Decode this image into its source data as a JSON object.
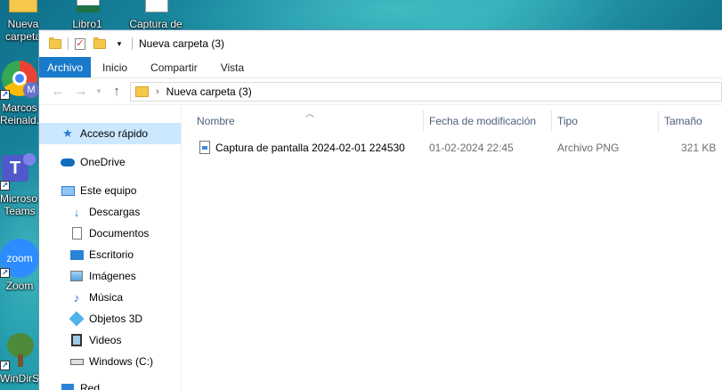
{
  "desktop": {
    "icons": [
      {
        "name": "nueva-carpeta",
        "label": "Nueva carpeta",
        "line1": "Nueva",
        "line2": "carpeta"
      },
      {
        "name": "libro1",
        "label": "Libro1"
      },
      {
        "name": "captura-de",
        "label": "Captura de"
      },
      {
        "name": "chrome-marcos",
        "line1": "Marcos",
        "line2": "Reinald..."
      },
      {
        "name": "teams",
        "line1": "Microso...",
        "line2": "Teams"
      },
      {
        "name": "zoom",
        "line1": "Zoom",
        "logo": "zoom"
      },
      {
        "name": "windirstat",
        "line1": "WinDirSt..."
      }
    ]
  },
  "window": {
    "title": "Nueva carpeta (3)",
    "ribbon_tabs": [
      "Archivo",
      "Inicio",
      "Compartir",
      "Vista"
    ],
    "address": {
      "path": "Nueva carpeta (3)",
      "chevron": "›"
    },
    "nav": {
      "quick_access": "Acceso rápido",
      "onedrive": "OneDrive",
      "this_pc": "Este equipo",
      "items": [
        {
          "label": "Descargas",
          "icon": "download-icon"
        },
        {
          "label": "Documentos",
          "icon": "document-icon"
        },
        {
          "label": "Escritorio",
          "icon": "desktop-icon"
        },
        {
          "label": "Imágenes",
          "icon": "pictures-icon"
        },
        {
          "label": "Música",
          "icon": "music-icon"
        },
        {
          "label": "Objetos 3D",
          "icon": "objects-3d-icon"
        },
        {
          "label": "Videos",
          "icon": "video-icon"
        },
        {
          "label": "Windows (C:)",
          "icon": "drive-icon"
        }
      ],
      "network_partial": "Red"
    },
    "columns": [
      "Nombre",
      "Fecha de modificación",
      "Tipo",
      "Tamaño"
    ],
    "files": [
      {
        "name": "Captura de pantalla 2024-02-01 224530",
        "modified": "01-02-2024 22:45",
        "type": "Archivo PNG",
        "size": "321 KB"
      }
    ]
  },
  "colors": {
    "ribbon_active": "#1979ca",
    "selected_nav": "#cce8ff",
    "header_text": "#4c607a"
  }
}
